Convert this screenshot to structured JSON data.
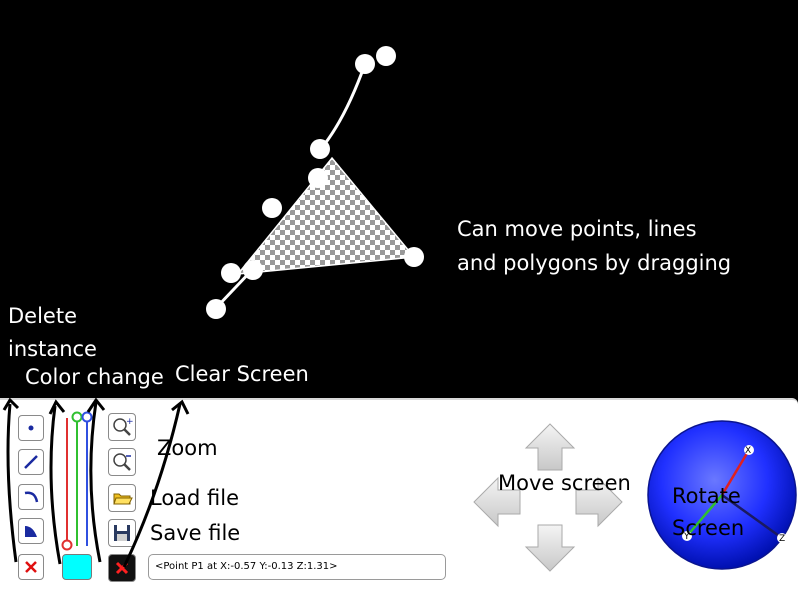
{
  "annotations": {
    "drag_hint_line1": "Can move points, lines",
    "drag_hint_line2": "and polygons by dragging",
    "delete_line1": "Delete",
    "delete_line2": "instance",
    "color_change": "Color change",
    "clear_screen": "Clear Screen",
    "zoom": "Zoom",
    "load_file": "Load file",
    "save_file": "Save file",
    "move_screen": "Move screen",
    "rotate_line1": "Rotate",
    "rotate_line2": "Screen"
  },
  "status_bar": {
    "text": "<Point P1 at X:-0.57 Y:-0.13 Z:1.31>"
  },
  "axes": {
    "x": "X",
    "y": "Y",
    "z": "Z"
  },
  "tools": [
    {
      "name": "point-tool",
      "icon": "dot-icon"
    },
    {
      "name": "line-tool",
      "icon": "line-icon"
    },
    {
      "name": "curve-tool",
      "icon": "curve-icon"
    },
    {
      "name": "polygon-tool",
      "icon": "polygon-icon"
    },
    {
      "name": "delete-tool",
      "icon": "red-x-icon"
    }
  ],
  "colors": {
    "current_color": "#00ffff",
    "red_slider": "#e03030",
    "green_slider": "#30c030",
    "blue_slider": "#3050e0",
    "globe": "#1a2cff"
  }
}
